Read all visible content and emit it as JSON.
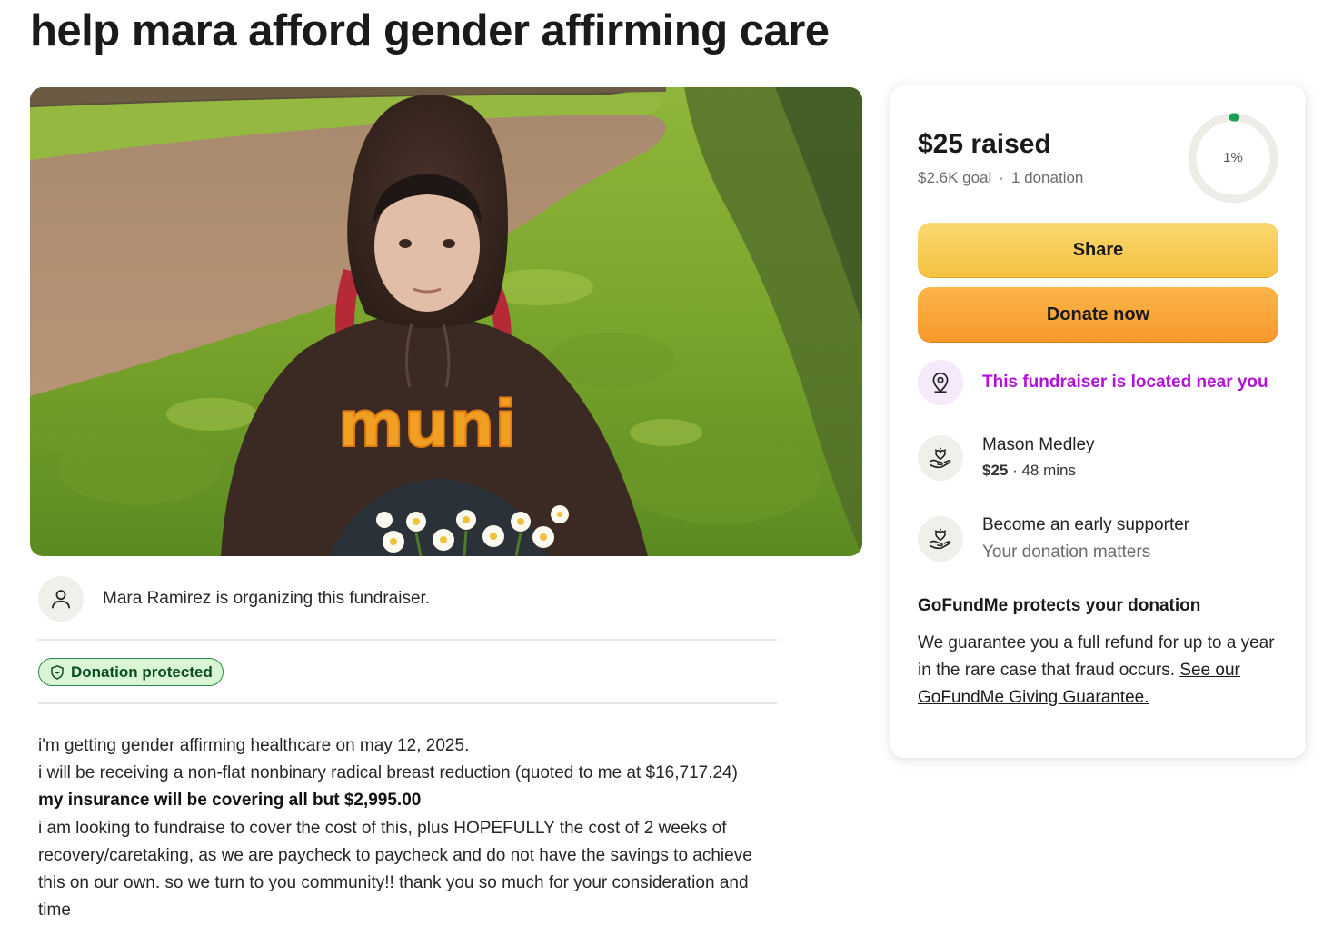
{
  "page": {
    "title": "help mara afford gender affirming care"
  },
  "hero": {
    "sweatshirt_logo_text": "muni"
  },
  "organizer": {
    "text": "Mara Ramirez is organizing this fundraiser."
  },
  "badge": {
    "label": "Donation protected"
  },
  "story": {
    "line1": "i'm getting gender affirming healthcare on may 12, 2025.",
    "line2": "i will be receiving a non-flat nonbinary radical breast reduction (quoted to me at $16,717.24)",
    "line3": "my insurance will be covering all but $2,995.00",
    "line4": "i am looking to fundraise to cover the cost of this, plus HOPEFULLY the cost of 2 weeks of recovery/caretaking, as we are paycheck to paycheck and do not have the savings to achieve this on our own. so we turn to you community!! thank you so much for your consideration and time"
  },
  "sidebar": {
    "raised": "$25 raised",
    "goal": "$2.6K goal",
    "separator": "·",
    "donation_count": "1 donation",
    "progress_label": "1%",
    "progress_fraction": 0.01,
    "share_label": "Share",
    "donate_label": "Donate now",
    "near_you": "This fundraiser is located near you",
    "donor": {
      "name": "Mason Medley",
      "amount": "$25",
      "meta": " · 48 mins"
    },
    "early": {
      "title": "Become an early supporter",
      "subtitle": "Your donation matters"
    },
    "protect": {
      "title": "GoFundMe protects your donation",
      "body": "We guarantee you a full refund for up to a year in the rare case that fraud occurs. ",
      "link": "See our GoFundMe Giving Guarantee."
    }
  },
  "colors": {
    "progress_green": "#1aa054",
    "near_purple": "#b212d8",
    "share_yellow": "#f4c140",
    "donate_orange": "#f7992a"
  }
}
